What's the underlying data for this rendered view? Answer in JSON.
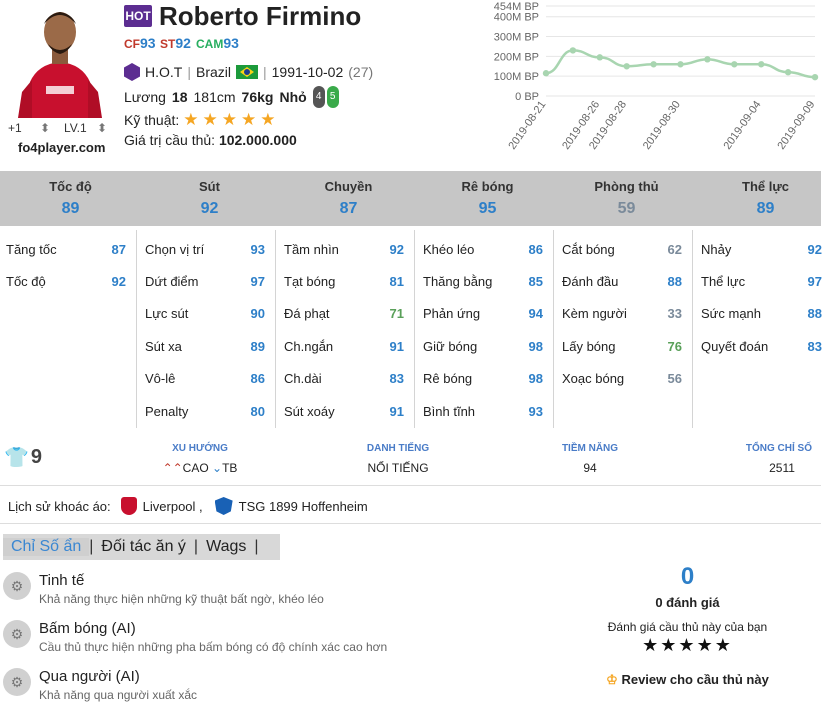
{
  "player": {
    "name": "Roberto Firmino",
    "season_badge": "HOT",
    "positions": [
      {
        "pos": "CF",
        "val": "93",
        "color": "#c0392b"
      },
      {
        "pos": "ST",
        "val": "92",
        "color": "#c0392b"
      },
      {
        "pos": "CAM",
        "val": "93",
        "color": "#27ae60"
      }
    ],
    "season": "H.O.T",
    "nation": "Brazil",
    "birthdate": "1991-10-02",
    "age": "(27)",
    "salary_label": "Lương",
    "salary": "18",
    "height": "181cm",
    "weight": "76kg",
    "build": "Nhỏ",
    "foot_left": "4",
    "foot_right": "5",
    "skill_label": "Kỹ thuật:",
    "skill_stars": 5,
    "value_label": "Giá trị cầu thủ:",
    "value": "102.000.000",
    "upgrade": "+1",
    "level": "LV.1",
    "site": "fo4player.com"
  },
  "chart_data": {
    "type": "line",
    "x": [
      "2019-08-21",
      "2019-08-24",
      "2019-08-26",
      "2019-08-28",
      "2019-08-29",
      "2019-08-30",
      "2019-09-01",
      "2019-09-03",
      "2019-09-04",
      "2019-09-07",
      "2019-09-09"
    ],
    "values": [
      115,
      230,
      195,
      150,
      160,
      160,
      185,
      160,
      160,
      120,
      95
    ],
    "tick_labels_x": [
      "2019-08-21",
      "2019-08-26",
      "2019-08-28",
      "2019-08-30",
      "2019-09-04",
      "2019-09-09"
    ],
    "tick_labels_y": [
      "0 BP",
      "100M BP",
      "200M BP",
      "300M BP",
      "400M BP",
      "454M BP"
    ],
    "ylim": [
      0,
      454
    ],
    "color": "#a8d5b0"
  },
  "stat_groups": [
    {
      "label": "Tốc độ",
      "value": "89",
      "color": "#2d7fc8",
      "items": [
        {
          "name": "Tăng tốc",
          "val": "87",
          "color": "#2d7fc8"
        },
        {
          "name": "Tốc độ",
          "val": "92",
          "color": "#2d7fc8"
        }
      ]
    },
    {
      "label": "Sút",
      "value": "92",
      "color": "#2d7fc8",
      "items": [
        {
          "name": "Chọn vị trí",
          "val": "93",
          "color": "#2d7fc8"
        },
        {
          "name": "Dứt điểm",
          "val": "97",
          "color": "#2d7fc8"
        },
        {
          "name": "Lực sút",
          "val": "90",
          "color": "#2d7fc8"
        },
        {
          "name": "Sút xa",
          "val": "89",
          "color": "#2d7fc8"
        },
        {
          "name": "Vô-lê",
          "val": "86",
          "color": "#2d7fc8"
        },
        {
          "name": "Penalty",
          "val": "80",
          "color": "#2d7fc8"
        }
      ]
    },
    {
      "label": "Chuyền",
      "value": "87",
      "color": "#2d7fc8",
      "items": [
        {
          "name": "Tầm nhìn",
          "val": "92",
          "color": "#2d7fc8"
        },
        {
          "name": "Tạt bóng",
          "val": "81",
          "color": "#2d7fc8"
        },
        {
          "name": "Đá phạt",
          "val": "71",
          "color": "#5aa05a"
        },
        {
          "name": "Ch.ngắn",
          "val": "91",
          "color": "#2d7fc8"
        },
        {
          "name": "Ch.dài",
          "val": "83",
          "color": "#2d7fc8"
        },
        {
          "name": "Sút xoáy",
          "val": "91",
          "color": "#2d7fc8"
        }
      ]
    },
    {
      "label": "Rê bóng",
      "value": "95",
      "color": "#2d7fc8",
      "items": [
        {
          "name": "Khéo léo",
          "val": "86",
          "color": "#2d7fc8"
        },
        {
          "name": "Thăng bằng",
          "val": "85",
          "color": "#2d7fc8"
        },
        {
          "name": "Phản ứng",
          "val": "94",
          "color": "#2d7fc8"
        },
        {
          "name": "Giữ bóng",
          "val": "98",
          "color": "#2d7fc8"
        },
        {
          "name": "Rê bóng",
          "val": "98",
          "color": "#2d7fc8"
        },
        {
          "name": "Bình tĩnh",
          "val": "93",
          "color": "#2d7fc8"
        }
      ]
    },
    {
      "label": "Phòng thủ",
      "value": "59",
      "color": "#7a8a9a",
      "items": [
        {
          "name": "Cắt bóng",
          "val": "62",
          "color": "#7a8a9a"
        },
        {
          "name": "Đánh đầu",
          "val": "88",
          "color": "#2d7fc8"
        },
        {
          "name": "Kèm người",
          "val": "33",
          "color": "#7a8a9a"
        },
        {
          "name": "Lấy bóng",
          "val": "76",
          "color": "#5aa05a"
        },
        {
          "name": "Xoạc bóng",
          "val": "56",
          "color": "#7a8a9a"
        }
      ]
    },
    {
      "label": "Thể lực",
      "value": "89",
      "color": "#2d7fc8",
      "items": [
        {
          "name": "Nhảy",
          "val": "92",
          "color": "#2d7fc8"
        },
        {
          "name": "Thể lực",
          "val": "97",
          "color": "#2d7fc8"
        },
        {
          "name": "Sức mạnh",
          "val": "88",
          "color": "#2d7fc8"
        },
        {
          "name": "Quyết đoán",
          "val": "83",
          "color": "#2d7fc8"
        }
      ]
    }
  ],
  "meta": {
    "shirt_number": "9",
    "trend_label": "XU HƯỚNG",
    "trend_up": "CAO",
    "trend_mid": "TB",
    "fame_label": "DANH TIẾNG",
    "fame": "NỔI TIẾNG",
    "potential_label": "TIỀM NĂNG",
    "potential": "94",
    "total_label": "TỔNG CHỈ SỐ",
    "total": "2511"
  },
  "clubs": {
    "label": "Lịch sử khoác áo:",
    "items": [
      "Liverpool ,",
      "TSG 1899 Hoffenheim"
    ]
  },
  "tabs": [
    "Chỉ Số ẩn",
    "Đối tác ăn ý",
    "Wags"
  ],
  "traits": [
    {
      "title": "Tinh tế",
      "desc": "Khả năng thực hiện những kỹ thuật bất ngờ, khéo léo"
    },
    {
      "title": "Bấm bóng (AI)",
      "desc": "Cầu thủ thực hiện những pha bấm bóng có độ chính xác cao hơn"
    },
    {
      "title": "Qua người (AI)",
      "desc": "Khả năng qua người xuất xắc"
    }
  ],
  "rating": {
    "score": "0",
    "count": "0 đánh giá",
    "prompt": "Đánh giá cầu thủ này của bạn",
    "stars": "★★★★★",
    "review": "Review cho cầu thủ này"
  }
}
